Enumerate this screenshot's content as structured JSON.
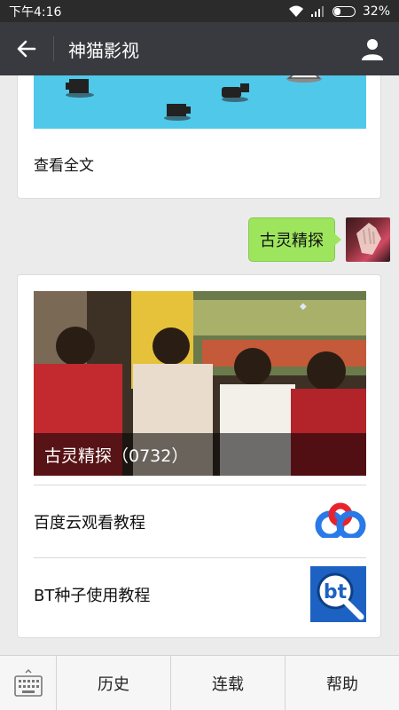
{
  "status_bar": {
    "time": "下午4:16",
    "battery": "32%",
    "battery_level": 0.32
  },
  "header": {
    "title": "神猫影视"
  },
  "card_top": {
    "link_text": "查看全文"
  },
  "sent_message": {
    "text": "古灵精探"
  },
  "card_main": {
    "cover_caption": "古灵精探（0732）",
    "items": [
      {
        "label": "百度云观看教程",
        "icon": "baidu-cloud-icon"
      },
      {
        "label": "BT种子使用教程",
        "icon": "bt-search-icon"
      }
    ]
  },
  "bottom_menu": {
    "items": [
      {
        "label": "历史"
      },
      {
        "label": "连载"
      },
      {
        "label": "帮助"
      }
    ]
  }
}
